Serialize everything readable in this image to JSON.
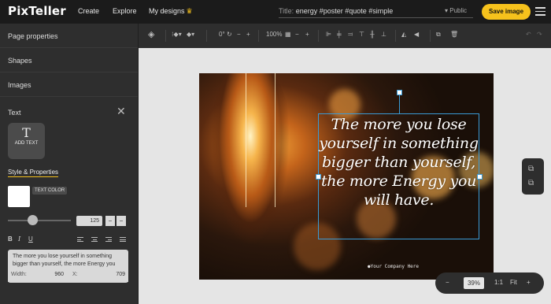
{
  "app": {
    "logo": "PixTeller"
  },
  "nav": {
    "create": "Create",
    "explore": "Explore",
    "my_designs": "My designs"
  },
  "title_field": {
    "label": "Title:",
    "value": "energy #poster #quote #simple"
  },
  "visibility": {
    "value": "Public"
  },
  "save_button": "Save image",
  "sidebar": {
    "items": [
      {
        "label": "Page properties"
      },
      {
        "label": "Shapes"
      },
      {
        "label": "Images"
      }
    ],
    "text_header": "Text",
    "add_text": {
      "glyph": "T",
      "label": "ADD TEXT"
    },
    "style_header": "Style & Properties",
    "text_color_tip": "TEXT COLOR",
    "font_size": "125",
    "text_value": "The more you lose yourself in something bigger than yourself, the more Energy you will have.",
    "width_label": "Width:",
    "width_value": "960",
    "x_label": "X:",
    "x_value": "709"
  },
  "toolbar": {
    "rotation": "0°",
    "opacity": "100%"
  },
  "canvas": {
    "quote": "The more you lose yourself in something bigger than yourself, the more Energy you will have.",
    "credit": "●Your Company Here"
  },
  "zoom": {
    "value": "39%",
    "fit_1": "1:1",
    "fit": "Fit"
  },
  "colors": {
    "accent": "#f6c21c",
    "selection": "#3a9bd6",
    "panel": "#2e2e2e",
    "topbar": "#1b1b1b"
  }
}
